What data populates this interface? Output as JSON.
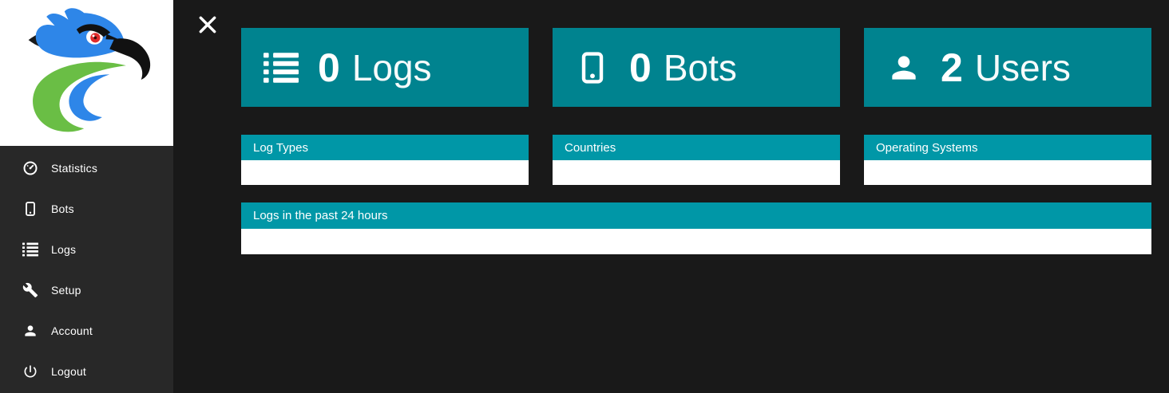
{
  "colors": {
    "sidebar_bg": "#282828",
    "main_bg": "#191919",
    "card_teal": "#00838f",
    "panel_header_teal": "#0097a7",
    "logo_blue": "#2e86e8",
    "logo_green": "#6abe45",
    "logo_red": "#e02b2b",
    "text_white": "#ffffff"
  },
  "logo": {
    "name": "eagle-logo"
  },
  "topbar": {
    "close_icon": "close-icon"
  },
  "sidebar": {
    "items": [
      {
        "label": "Statistics",
        "icon": "gauge-icon"
      },
      {
        "label": "Bots",
        "icon": "smartphone-icon"
      },
      {
        "label": "Logs",
        "icon": "list-icon"
      },
      {
        "label": "Setup",
        "icon": "wrench-icon"
      },
      {
        "label": "Account",
        "icon": "person-icon"
      },
      {
        "label": "Logout",
        "icon": "power-icon"
      }
    ]
  },
  "stat_cards": [
    {
      "value": "0",
      "label": "Logs",
      "icon": "list-icon"
    },
    {
      "value": "0",
      "label": "Bots",
      "icon": "smartphone-icon"
    },
    {
      "value": "2",
      "label": "Users",
      "icon": "person-icon"
    }
  ],
  "panels": [
    {
      "title": "Log Types"
    },
    {
      "title": "Countries"
    },
    {
      "title": "Operating Systems"
    }
  ],
  "wide_panel": {
    "title": "Logs in the past 24 hours"
  }
}
